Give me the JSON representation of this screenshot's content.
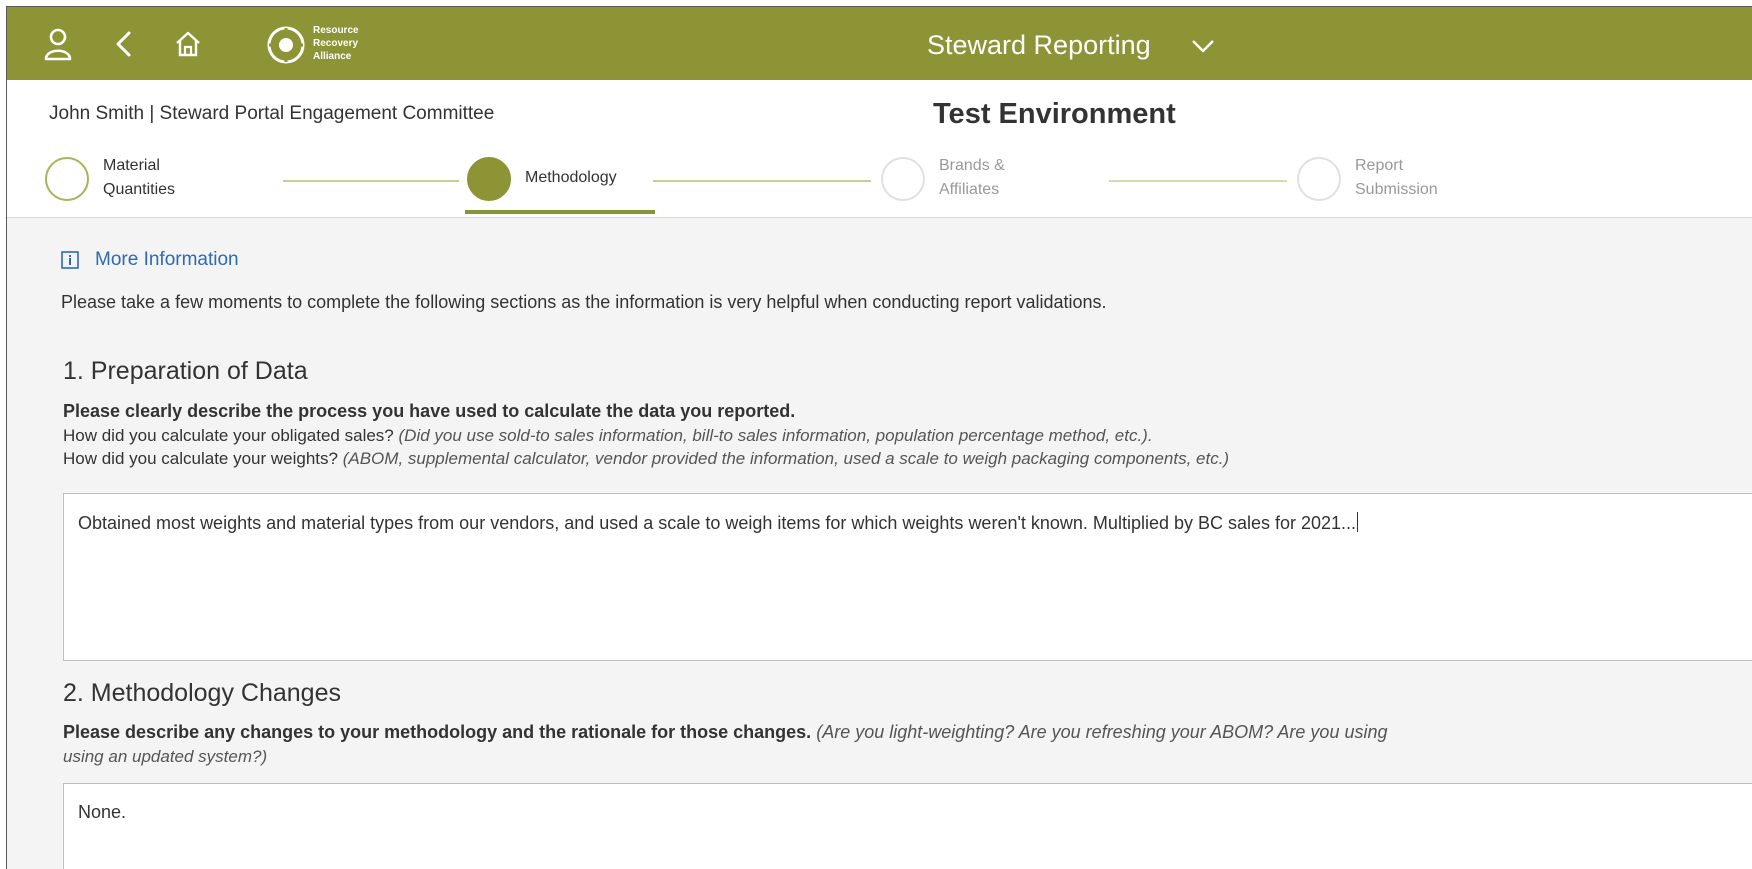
{
  "shell": {
    "app_title": "Steward Reporting",
    "logo_lines": [
      "Resource",
      "Recovery",
      "Alliance"
    ],
    "icons": [
      "user-icon",
      "back-icon",
      "home-icon",
      "chevron-down-icon"
    ],
    "background_color": "#8c9435"
  },
  "header": {
    "user_line": "John Smith | Steward Portal Engagement Committee",
    "environment": "Test Environment"
  },
  "steps": [
    {
      "line1": "Material",
      "line2": "Quantities",
      "state": "completed"
    },
    {
      "line1": "Methodology",
      "line2": "",
      "state": "active"
    },
    {
      "line1": "Brands &",
      "line2": "Affiliates",
      "state": "future"
    },
    {
      "line1": "Report",
      "line2": "Submission",
      "state": "future"
    }
  ],
  "content": {
    "more_info": "More Information",
    "intro": "Please take a few moments to complete the following sections as the information is very helpful when conducting report validations.",
    "section1": {
      "title": "1. Preparation of Data",
      "question": "Please clearly describe the process you have used to calculate the data you reported.",
      "line1_text": "How did you calculate your obligated sales?",
      "line1_hint": "(Did you use sold-to sales information, bill-to sales information, population percentage method, etc.).",
      "line2_text": "How did you calculate your weights?",
      "line2_hint": "(ABOM, supplemental calculator, vendor provided the information, used a scale to weigh packaging components, etc.)",
      "answer": "Obtained most weights and material types from our vendors, and used a scale to weigh items for which weights weren't known. Multiplied by BC sales for 2021..."
    },
    "section2": {
      "title": "2. Methodology Changes",
      "question": "Please describe any changes to your methodology and the rationale for those changes.",
      "hint": "(Are you light-weighting? Are you refreshing your ABOM? Are you using",
      "hint_line2": "using an updated system?)",
      "answer": "None."
    }
  }
}
